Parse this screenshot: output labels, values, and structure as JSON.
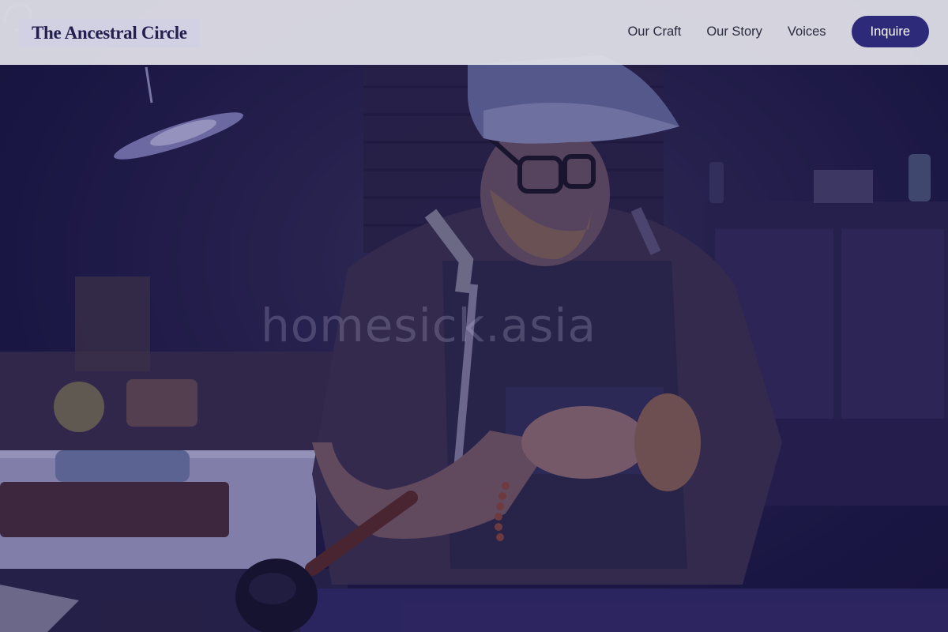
{
  "brand": {
    "name": "The Ancestral Circle"
  },
  "nav": {
    "links": [
      "Our Craft",
      "Our Story",
      "Voices"
    ],
    "cta_label": "Inquire"
  },
  "hero": {
    "watermark_text": "homesick.asia"
  },
  "colors": {
    "header_bg": "#e2e2ea",
    "brand_text": "#23204f",
    "accent": "#2d2a7a",
    "hero_tint": "#1a1646"
  }
}
